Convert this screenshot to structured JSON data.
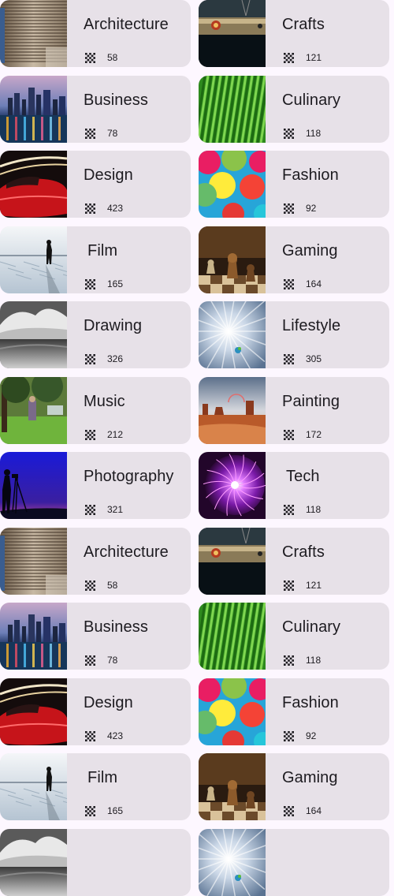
{
  "topics": [
    {
      "name": "Architecture",
      "count": "58",
      "image": "architecture"
    },
    {
      "name": "Crafts",
      "count": "121",
      "image": "crafts"
    },
    {
      "name": "Business",
      "count": "78",
      "image": "business"
    },
    {
      "name": "Culinary",
      "count": "118",
      "image": "culinary"
    },
    {
      "name": "Design",
      "count": "423",
      "image": "design"
    },
    {
      "name": "Fashion",
      "count": "92",
      "image": "fashion"
    },
    {
      "name": "Film",
      "count": "165",
      "image": "film"
    },
    {
      "name": "Gaming",
      "count": "164",
      "image": "gaming"
    },
    {
      "name": "Drawing",
      "count": "326",
      "image": "drawing"
    },
    {
      "name": "Lifestyle",
      "count": "305",
      "image": "lifestyle"
    },
    {
      "name": "Music",
      "count": "212",
      "image": "music"
    },
    {
      "name": "Painting",
      "count": "172",
      "image": "painting"
    },
    {
      "name": "Photography",
      "count": "321",
      "image": "photography"
    },
    {
      "name": "Tech",
      "count": "118",
      "image": "tech"
    },
    {
      "name": "Architecture",
      "count": "58",
      "image": "architecture"
    },
    {
      "name": "Crafts",
      "count": "121",
      "image": "crafts"
    },
    {
      "name": "Business",
      "count": "78",
      "image": "business"
    },
    {
      "name": "Culinary",
      "count": "118",
      "image": "culinary"
    },
    {
      "name": "Design",
      "count": "423",
      "image": "design"
    },
    {
      "name": "Fashion",
      "count": "92",
      "image": "fashion"
    },
    {
      "name": "Film",
      "count": "165",
      "image": "film"
    },
    {
      "name": "Gaming",
      "count": "164",
      "image": "gaming"
    },
    {
      "name": "",
      "count": "",
      "image": "drawing"
    },
    {
      "name": "",
      "count": "",
      "image": "lifestyle"
    }
  ],
  "count_icon": "grid-icon",
  "colors": {
    "background": "#fdf7ff",
    "card": "#e7e1e8",
    "text": "#1d1b20"
  }
}
